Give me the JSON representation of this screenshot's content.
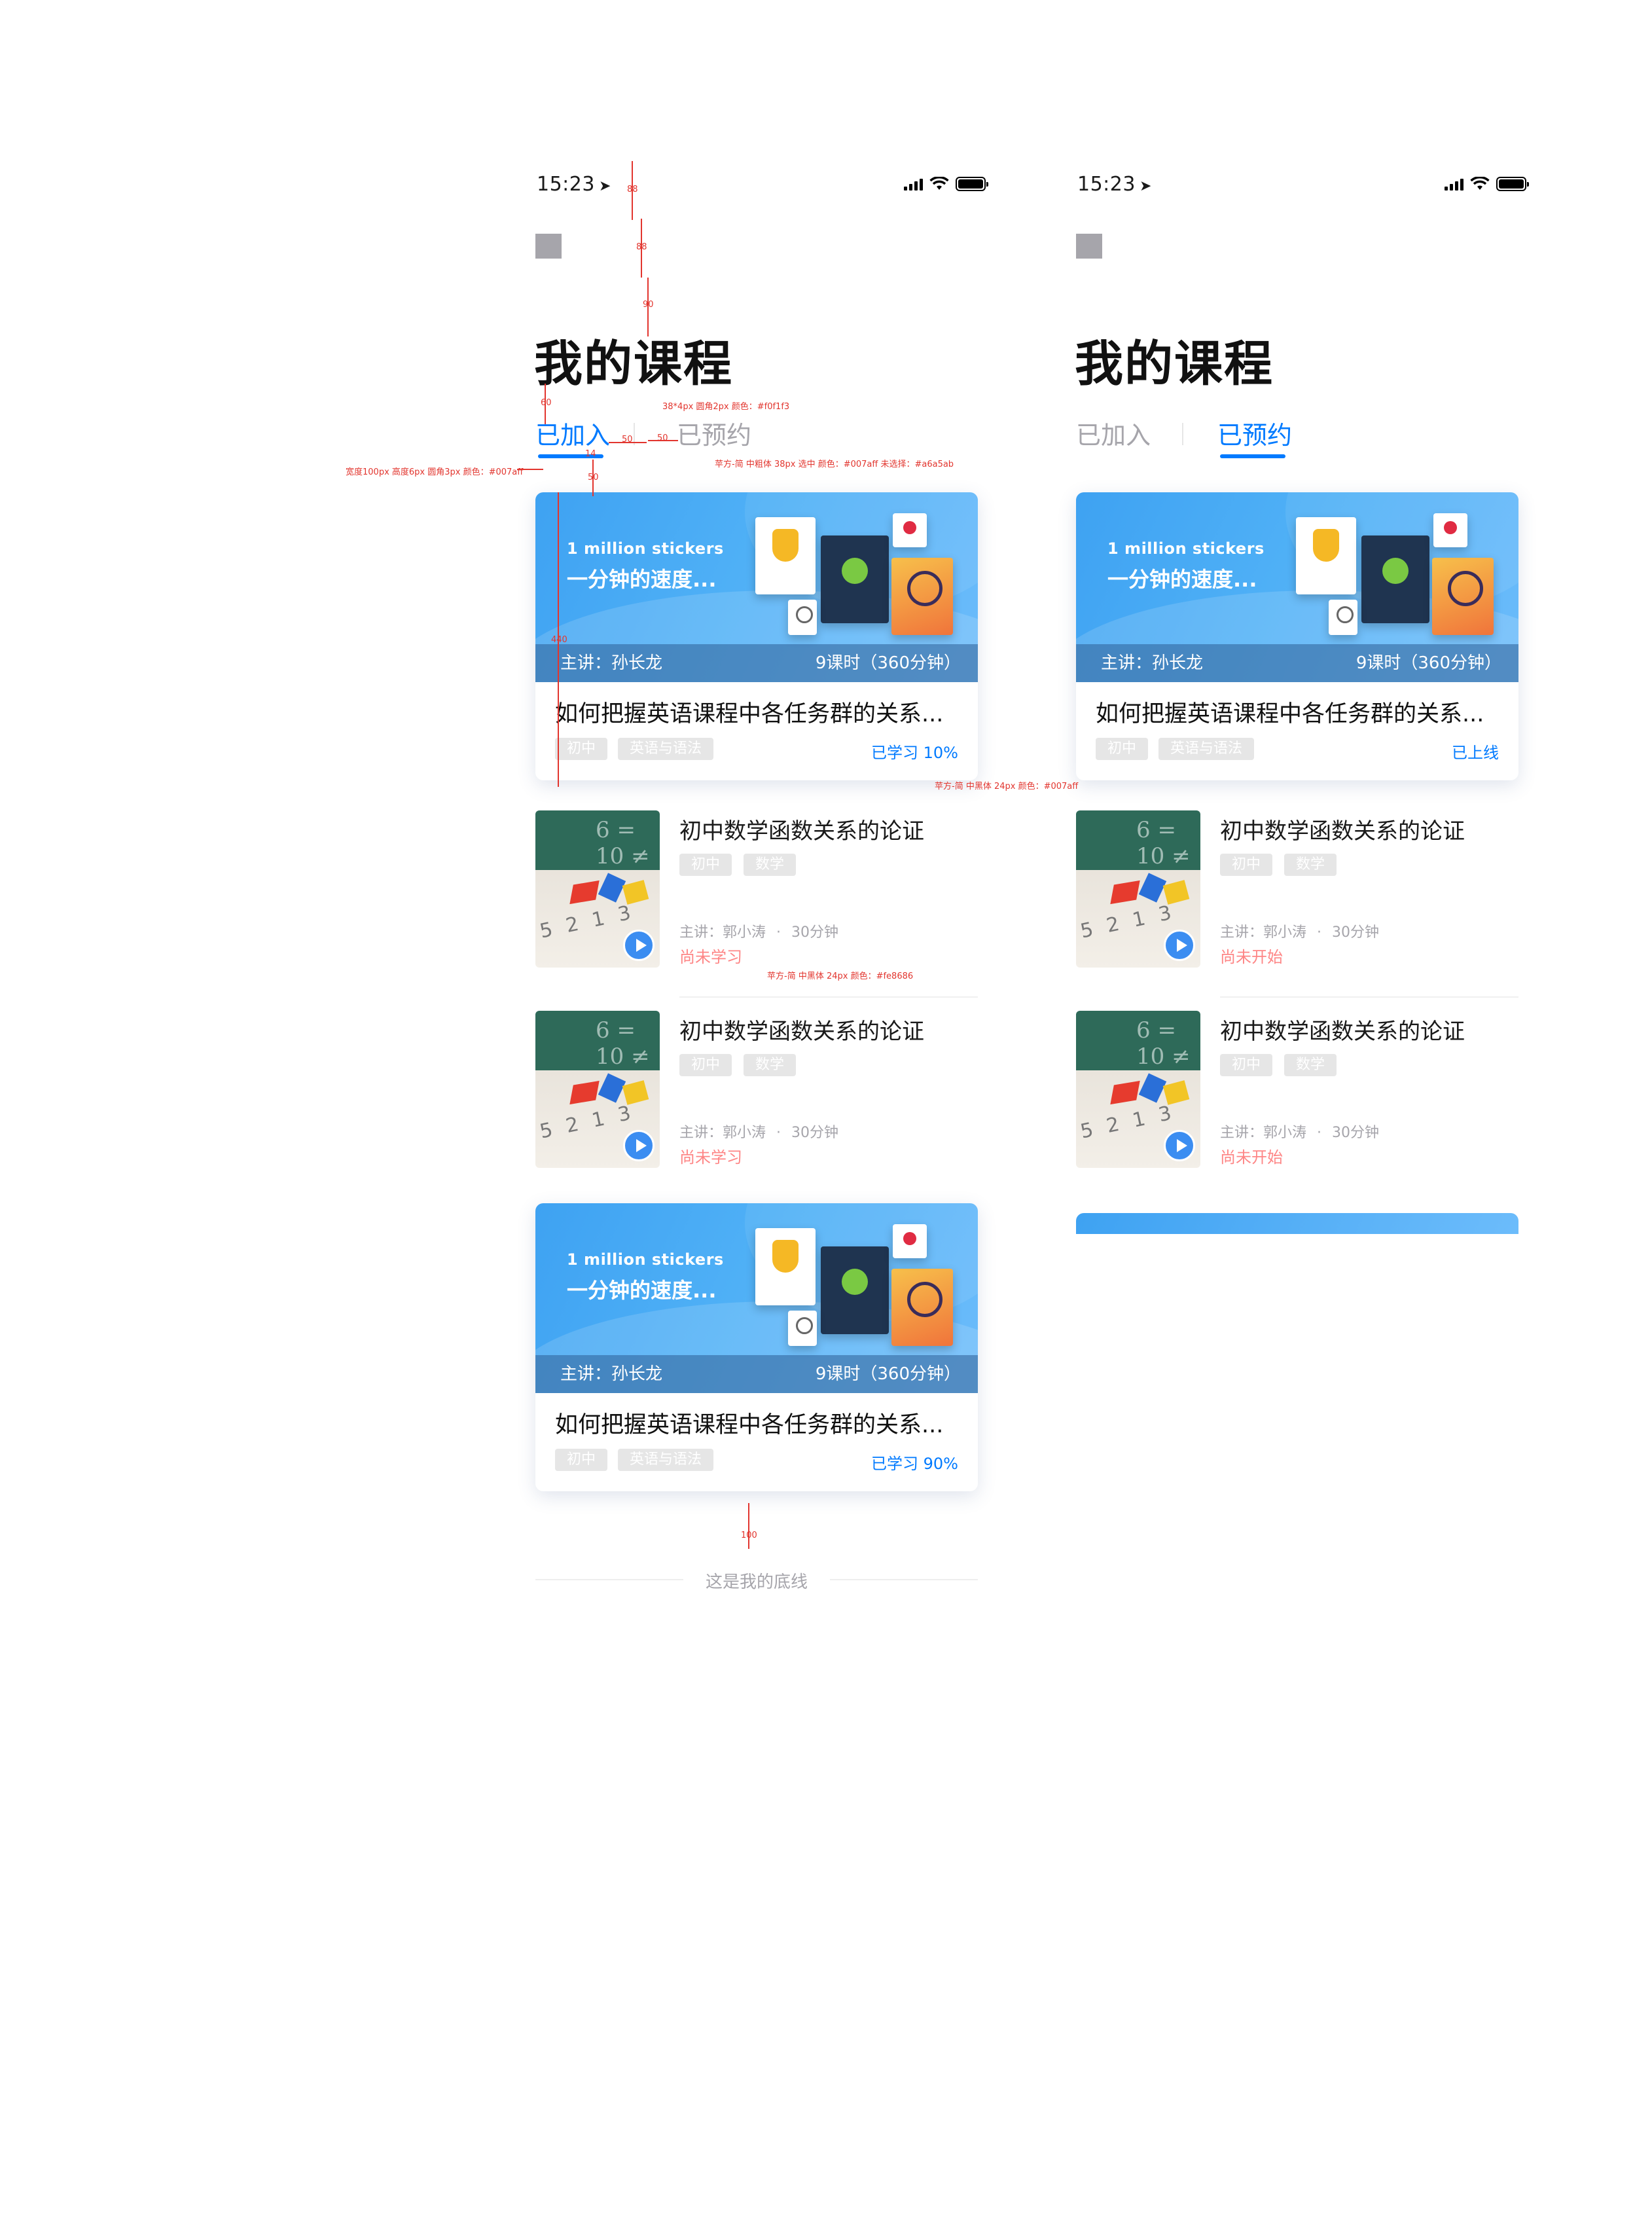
{
  "status": {
    "time": "15:23"
  },
  "page_title": "我的课程",
  "tabs": {
    "joined": "已加入",
    "reserved": "已预约"
  },
  "featured_course": {
    "banner_english": "1 million stickers",
    "banner_chinese": "一分钟的速度...",
    "teacher": "主讲：孙长龙",
    "hours": "9课时（360分钟）",
    "title": "如何把握英语课程中各任务群的关系...",
    "tags": [
      "初中",
      "英语与语法"
    ]
  },
  "screen_a": {
    "card1_progress": "已学习 10%",
    "card2_progress": "已学习 90%",
    "row_status": "尚未学习"
  },
  "screen_b": {
    "card1_status": "已上线",
    "row_status": "尚未开始"
  },
  "lesson": {
    "title": "初中数学函数关系的论证",
    "tags": [
      "初中",
      "数学"
    ],
    "teacher": "主讲：郭小涛",
    "separator": "·",
    "duration": "30分钟"
  },
  "footer_text": "这是我的底线",
  "annotations": {
    "spacing_88": "88",
    "spacing_90": "90",
    "spacing_60": "60",
    "spacing_50": "50",
    "spacing_14": "14",
    "spacing_440": "440",
    "spacing_100": "100",
    "divider_spec": "38*4px 圆角2px 颜色：#f0f1f3",
    "tab_spec": "苹方-简 中粗体 38px 选中 颜色：#007aff 未选择：#a6a5ab",
    "underline_spec": "宽度100px 高度6px 圆角3px 颜色：#007aff",
    "progress_spec": "苹方-简 中黑体 24px 颜色：#007aff",
    "status_spec": "苹方-简 中黑体 24px 颜色：#fe8686"
  }
}
